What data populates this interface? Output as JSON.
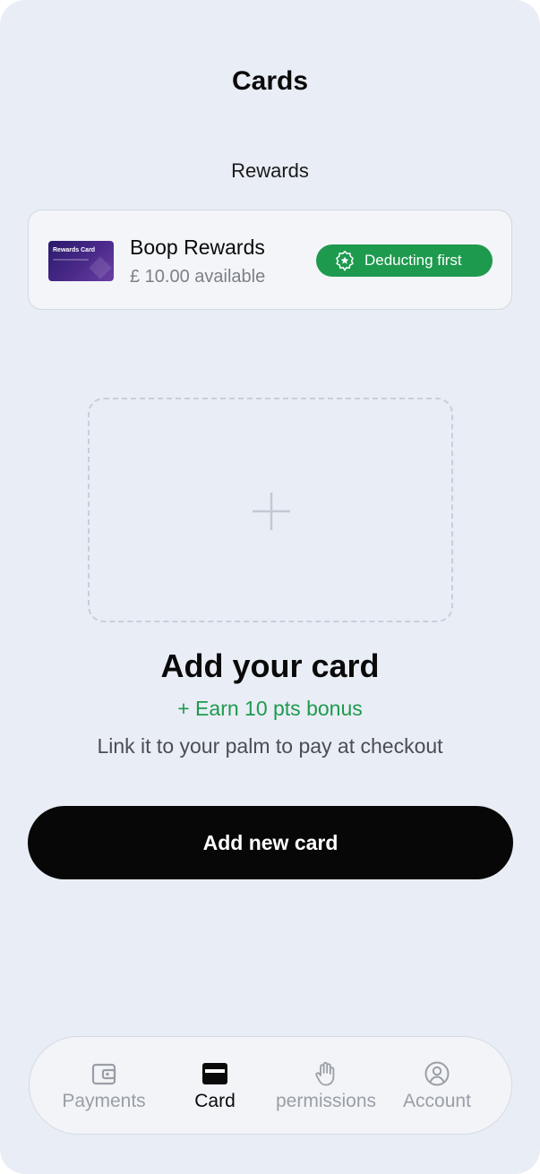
{
  "header": {
    "title": "Cards"
  },
  "rewards_section": {
    "label": "Rewards",
    "card": {
      "thumb_text": "Rewards Card",
      "name": "Boop Rewards",
      "available": "£ 10.00 available",
      "badge_label": "Deducting first",
      "badge_icon": "star-badge-icon",
      "badge_color": "#1e9a4f"
    }
  },
  "add_card": {
    "placeholder_icon": "plus-icon",
    "heading": "Add your card",
    "bonus": "+ Earn 10 pts bonus",
    "subtext": "Link it to your palm to pay at checkout",
    "button_label": "Add new card"
  },
  "tabbar": {
    "tabs": [
      {
        "label": "Payments",
        "icon": "wallet-icon",
        "active": false
      },
      {
        "label": "Card",
        "icon": "credit-card-icon",
        "active": true
      },
      {
        "label": "permissions",
        "icon": "hand-icon",
        "active": false
      },
      {
        "label": "Account",
        "icon": "user-circle-icon",
        "active": false
      }
    ]
  }
}
